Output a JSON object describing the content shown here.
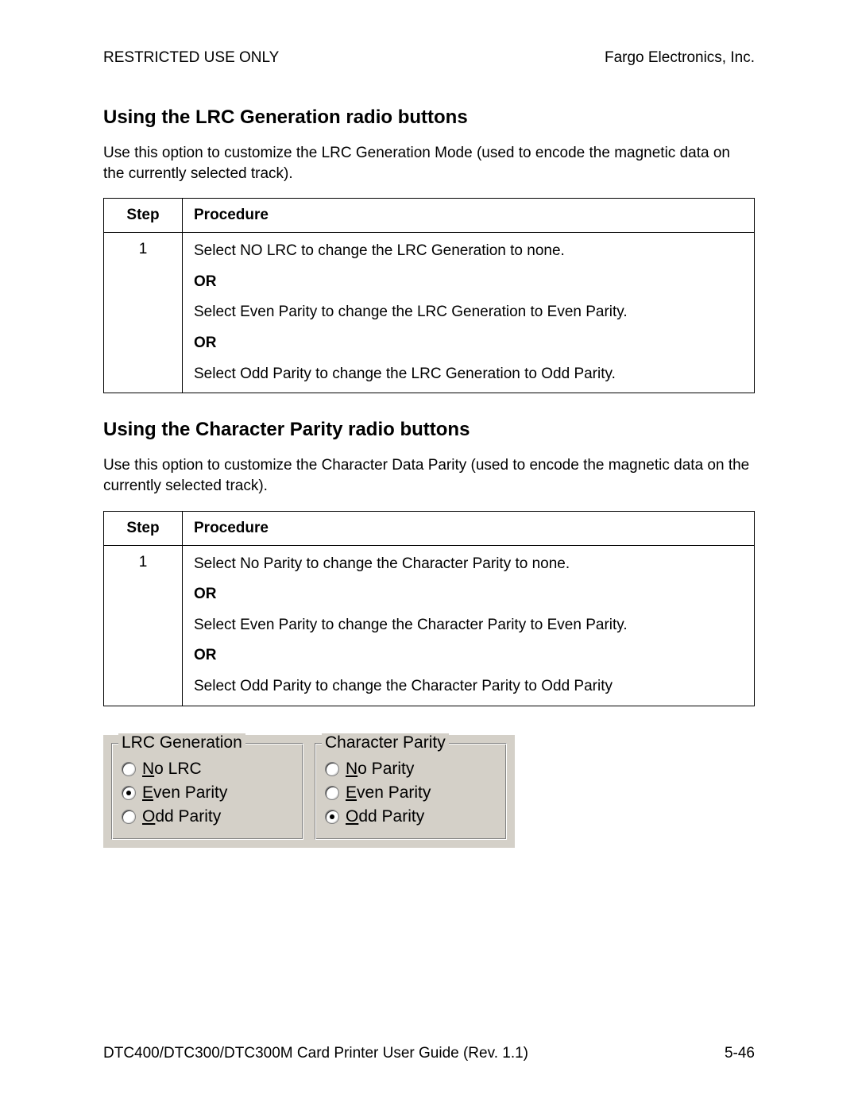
{
  "header": {
    "left": "RESTRICTED USE ONLY",
    "right": "Fargo Electronics, Inc."
  },
  "section1": {
    "title": "Using the LRC Generation radio buttons",
    "intro": "Use this option to customize the LRC Generation Mode (used to encode the magnetic data on the currently selected track).",
    "col_step": "Step",
    "col_proc": "Procedure",
    "step_num": "1",
    "proc": {
      "l1": "Select NO LRC to change the LRC Generation to none.",
      "or1": "OR",
      "l2": "Select Even Parity to change the LRC Generation to Even Parity.",
      "or2": "OR",
      "l3": "Select Odd Parity to change the LRC Generation to Odd Parity."
    }
  },
  "section2": {
    "title": "Using the Character Parity radio buttons",
    "intro": "Use this option to customize the Character Data Parity (used to encode the magnetic data on the currently selected track).",
    "col_step": "Step",
    "col_proc": "Procedure",
    "step_num": "1",
    "proc": {
      "l1": "Select No Parity to change the Character Parity to none.",
      "or1": "OR",
      "l2": "Select Even Parity to change the Character Parity to Even Parity.",
      "or2": "OR",
      "l3": "Select Odd Parity to change the Character Parity to Odd Parity"
    }
  },
  "ui": {
    "lrc": {
      "legend": "LRC Generation",
      "opt1_u": "N",
      "opt1_rest": "o LRC",
      "opt2_u": "E",
      "opt2_rest": "ven Parity",
      "opt3_u": "O",
      "opt3_rest": "dd Parity",
      "selected": 2
    },
    "cp": {
      "legend": "Character Parity",
      "opt1_u": "N",
      "opt1_rest": "o Parity",
      "opt2_u": "E",
      "opt2_rest": "ven Parity",
      "opt3_u": "O",
      "opt3_rest": "dd Parity",
      "selected": 3
    }
  },
  "footer": {
    "left": "DTC400/DTC300/DTC300M Card Printer User Guide (Rev. 1.1)",
    "right": "5-46"
  }
}
